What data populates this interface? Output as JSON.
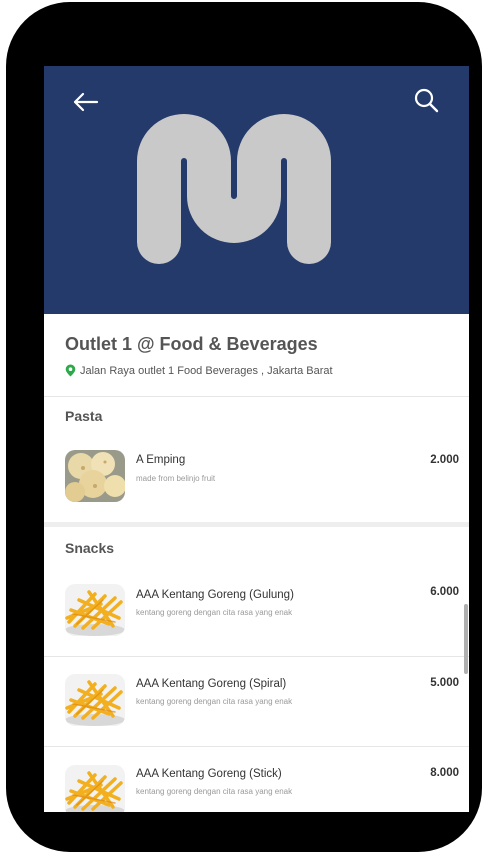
{
  "outlet": {
    "name": "Outlet 1 @ Food & Beverages",
    "address": "Jalan Raya outlet 1 Food Beverages , Jakarta Barat"
  },
  "icons": {
    "back": "arrow-left-icon",
    "search": "search-icon",
    "location": "location-pin-icon"
  },
  "colors": {
    "hero_bg": "#243a6b",
    "logo": "#c9c9c9",
    "pin": "#2ea94a"
  },
  "categories": [
    {
      "title": "Pasta",
      "items": [
        {
          "name": "A Emping",
          "description": "made from belinjo fruit",
          "price": "2.000"
        }
      ]
    },
    {
      "title": "Snacks",
      "items": [
        {
          "name": "AAA Kentang Goreng (Gulung)",
          "description": "kentang goreng dengan cita rasa yang enak",
          "price": "6.000"
        },
        {
          "name": "AAA Kentang Goreng (Spiral)",
          "description": "kentang goreng dengan cita rasa yang enak",
          "price": "5.000"
        },
        {
          "name": "AAA Kentang Goreng (Stick)",
          "description": "kentang goreng dengan cita rasa yang enak",
          "price": "8.000"
        }
      ]
    }
  ]
}
